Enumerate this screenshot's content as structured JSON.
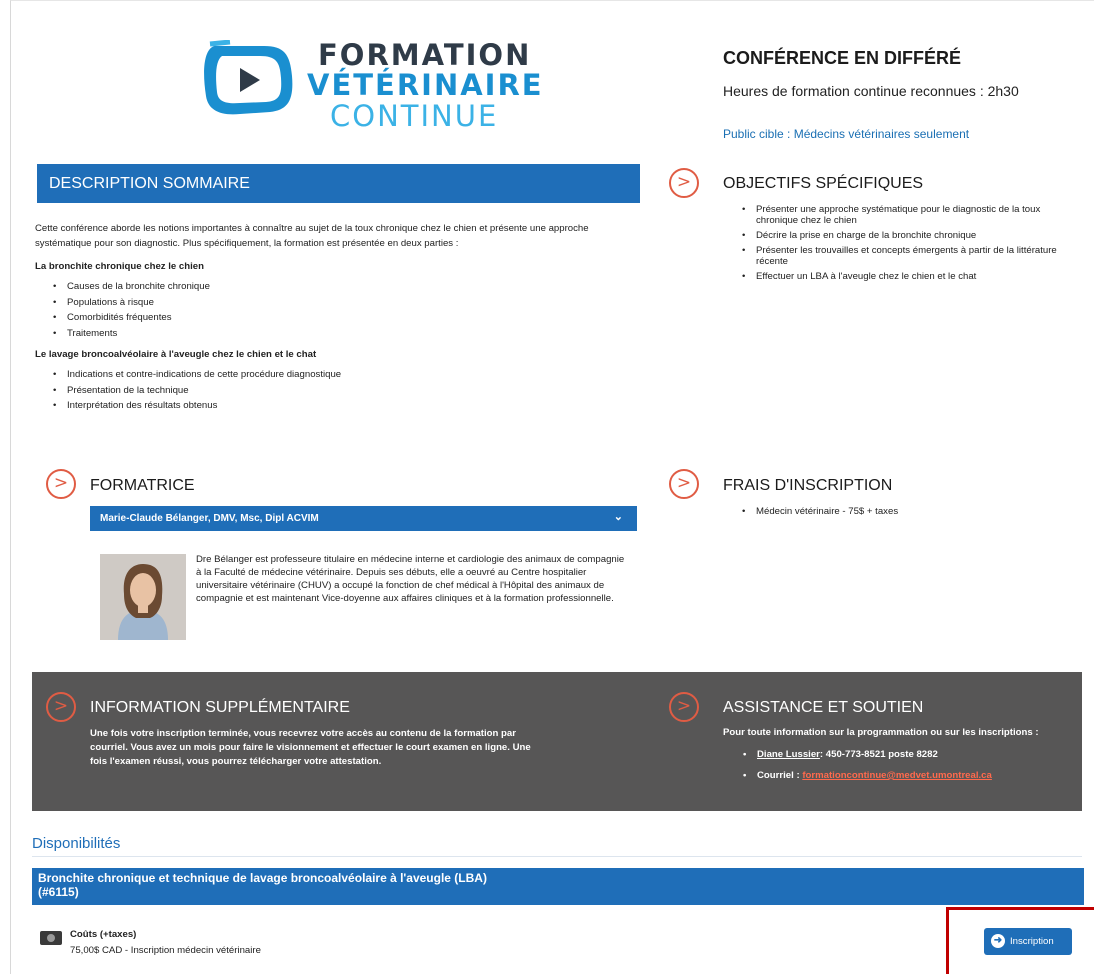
{
  "logo": {
    "line1": "FORMATION",
    "line2": "VÉTÉRINAIRE",
    "line3": "CONTINUE",
    "icon": "play-video-icon"
  },
  "conference": {
    "title": "CONFÉRENCE EN DIFFÉRÉ",
    "hours": "Heures de formation continue reconnues : 2h30",
    "public_cible": "Public cible : Médecins vétérinaires seulement"
  },
  "description": {
    "header": "DESCRIPTION SOMMAIRE",
    "intro": "Cette conférence aborde les notions importantes à connaître au sujet de la toux chronique chez le chien et présente une approche systématique pour son diagnostic. Plus spécifiquement, la formation est présentée en deux parties :",
    "part1_title": "La bronchite chronique chez le chien",
    "part1_items": [
      "Causes de la bronchite chronique",
      "Populations à risque",
      "Comorbidités fréquentes",
      "Traitements"
    ],
    "part2_title": "Le lavage broncoalvéolaire à l'aveugle chez le chien et le chat",
    "part2_items": [
      "Indications et contre-indications de cette procédure diagnostique",
      "Présentation de la technique",
      "Interprétation des résultats obtenus"
    ]
  },
  "objectifs": {
    "title": "OBJECTIFS SPÉCIFIQUES",
    "items": [
      "Présenter une approche systématique pour le diagnostic de la toux chronique chez le chien",
      "Décrire la prise en charge de la bronchite chronique",
      "Présenter les trouvailles et concepts émergents à partir de la littérature récente",
      "Effectuer un LBA à l'aveugle chez le chien et le chat"
    ]
  },
  "formatrice": {
    "title": "FORMATRICE",
    "name": "Marie-Claude Bélanger, DMV, Msc, Dipl ACVIM",
    "bio": "Dre Bélanger est professeure titulaire en médecine interne et cardiologie des animaux de compagnie à la Faculté de médecine vétérinaire. Depuis ses débuts, elle a oeuvré au Centre hospitalier universitaire vétérinaire (CHUV) a occupé la fonction de chef médical à l'Hôpital des animaux de compagnie et est maintenant Vice-doyenne aux affaires cliniques et à la formation professionnelle."
  },
  "frais": {
    "title": "FRAIS D'INSCRIPTION",
    "item": "Médecin vétérinaire - 75$ + taxes"
  },
  "info": {
    "title": "INFORMATION SUPPLÉMENTAIRE",
    "text": "Une fois votre inscription terminée, vous recevrez votre accès au contenu de la formation par courriel. Vous avez un mois pour faire le visionnement et effectuer le court examen en ligne. Une fois l'examen réussi, vous pourrez télécharger votre attestation."
  },
  "assistance": {
    "title": "ASSISTANCE ET SOUTIEN",
    "intro": "Pour toute information sur la programmation ou sur les inscriptions :",
    "contact_name": "Diane Lussier",
    "contact_phone": ": 450-773-8521 poste 8282",
    "email_label": "Courriel : ",
    "email": "formationcontinue@medvet.umontreal.ca"
  },
  "disponibilites": {
    "title": "Disponibilités",
    "course_title_1": "Bronchite chronique et technique de lavage broncoalvéolaire à l'aveugle (LBA)",
    "course_title_2": "(#6115)",
    "cost_label": "Coûts (+taxes)",
    "cost_detail": "75,00$ CAD - Inscription médecin vétérinaire",
    "button_label": "Inscription"
  },
  "colors": {
    "primary_blue": "#1f6eb8",
    "accent_orange": "#e05c44",
    "dark_band": "#575656",
    "highlight_red": "#c00000"
  }
}
